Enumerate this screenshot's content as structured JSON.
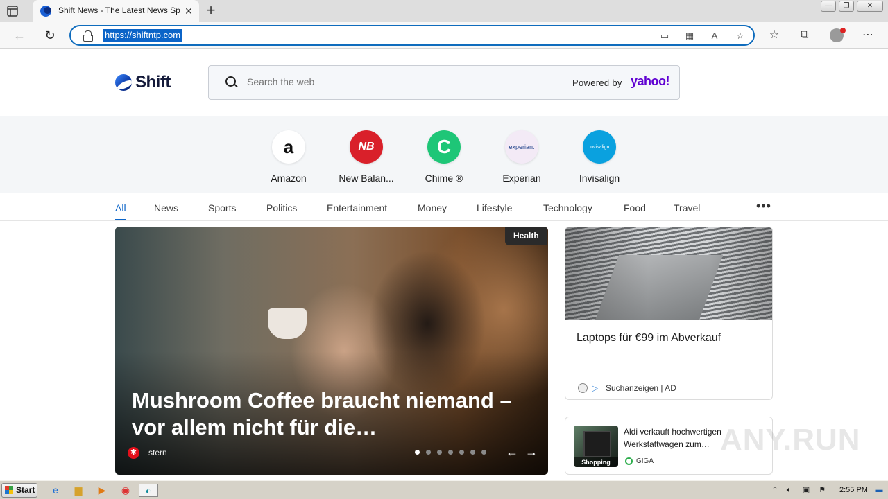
{
  "browser": {
    "tab_title": "Shift News - The Latest News Spo",
    "tab_close": "✕",
    "new_tab": "+",
    "url": "https://shiftntp.com",
    "window_buttons": [
      "—",
      "❐",
      "✕"
    ]
  },
  "header": {
    "logo_text": "Shift",
    "search_placeholder": "Search the web",
    "powered_by": "Powered by",
    "yahoo": "yahoo!"
  },
  "quicklinks": [
    {
      "label": "Amazon",
      "glyph": "a",
      "bg": "#ffffff",
      "fg": "#111111"
    },
    {
      "label": "New Balan...",
      "glyph": "NB",
      "bg": "#d9202a",
      "fg": "#ffffff"
    },
    {
      "label": "Chime ®",
      "glyph": "C",
      "bg": "#1ec677",
      "fg": "#ffffff"
    },
    {
      "label": "Experian",
      "glyph": "experian.",
      "bg": "#f3eaf6",
      "fg": "#26478d"
    },
    {
      "label": "Invisalign",
      "glyph": "invisalign",
      "bg": "#0aa1df",
      "fg": "#ffffff"
    }
  ],
  "categories": [
    "All",
    "News",
    "Sports",
    "Politics",
    "Entertainment",
    "Money",
    "Lifestyle",
    "Technology",
    "Food",
    "Travel"
  ],
  "hero": {
    "badge": "Health",
    "title": "Mushroom Coffee braucht niemand – vor allem nicht für die…",
    "source": "stern",
    "slide_count": 7,
    "active_slide": 1,
    "prev": "←",
    "next": "→"
  },
  "ad_card": {
    "title": "Laptops für €99 im Abverkauf",
    "source": "Suchanzeigen | AD"
  },
  "card2": {
    "title": "Aldi verkauft hochwertigen Werkstattwagen zum…",
    "badge": "Shopping",
    "source": "GIGA"
  },
  "watermark": "ANY.RUN",
  "taskbar": {
    "start": "Start",
    "time": "2:55 PM"
  }
}
